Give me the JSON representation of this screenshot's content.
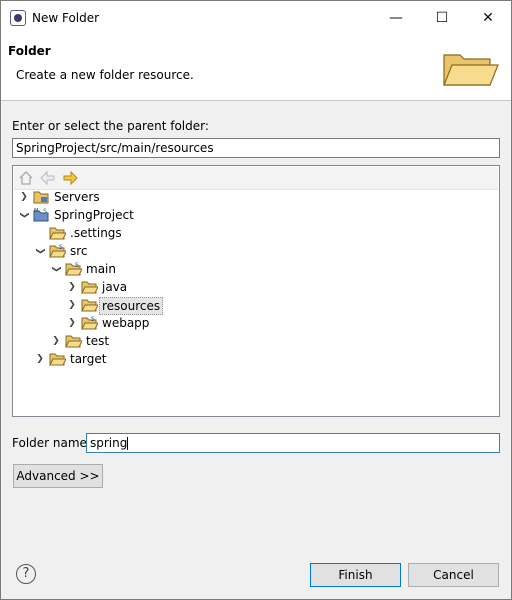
{
  "window": {
    "title": "New Folder",
    "minimize_symbol": "—",
    "maximize_symbol": "☐",
    "close_symbol": "✕"
  },
  "header": {
    "title": "Folder",
    "description": "Create a new folder resource."
  },
  "parent": {
    "label": "Enter or select the parent folder:",
    "value": "SpringProject/src/main/resources"
  },
  "tree": {
    "toolbar": [
      "home-icon",
      "back-arrow-icon",
      "forward-arrow-icon"
    ],
    "items": [
      {
        "label": "Servers",
        "expanded": false,
        "icon": "folder-icon"
      },
      {
        "label": "SpringProject",
        "expanded": true,
        "icon": "maven-spring-project-icon"
      },
      {
        "label": ".settings",
        "expanded": null,
        "icon": "folder-icon"
      },
      {
        "label": "src",
        "expanded": true,
        "icon": "spring-source-folder-icon"
      },
      {
        "label": "main",
        "expanded": true,
        "icon": "spring-source-folder-icon"
      },
      {
        "label": "java",
        "expanded": false,
        "icon": "folder-icon"
      },
      {
        "label": "resources",
        "expanded": false,
        "icon": "folder-open-icon",
        "selected": true
      },
      {
        "label": "webapp",
        "expanded": false,
        "icon": "spring-folder-icon"
      },
      {
        "label": "test",
        "expanded": false,
        "icon": "folder-icon"
      },
      {
        "label": "target",
        "expanded": false,
        "icon": "folder-icon"
      }
    ]
  },
  "folder_name": {
    "label": "Folder name:",
    "value": "spring"
  },
  "buttons": {
    "advanced": "Advanced >>",
    "finish": "Finish",
    "cancel": "Cancel",
    "help": "?"
  },
  "colors": {
    "accent": "#0078d7",
    "folder": "#e8b84a"
  }
}
